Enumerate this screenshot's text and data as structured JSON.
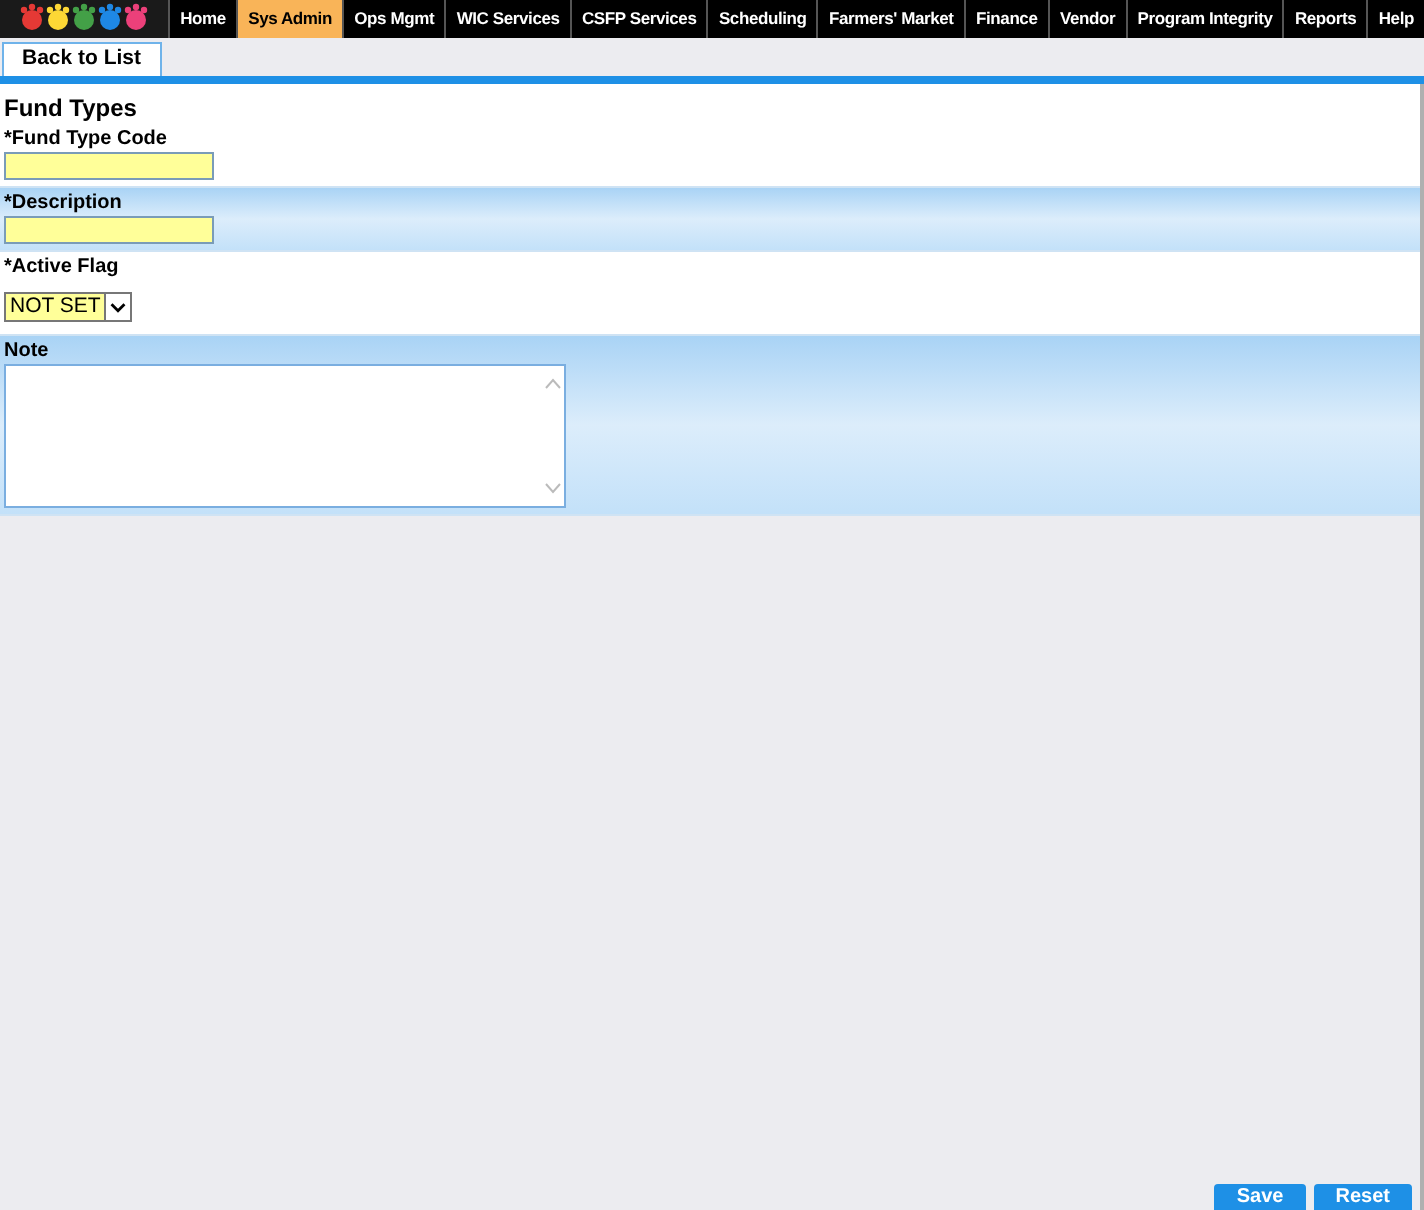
{
  "nav": [
    {
      "label": "Home",
      "selected": false
    },
    {
      "label": "Sys Admin",
      "selected": true
    },
    {
      "label": "Ops Mgmt",
      "selected": false
    },
    {
      "label": "WIC Services",
      "selected": false
    },
    {
      "label": "CSFP Services",
      "selected": false
    },
    {
      "label": "Scheduling",
      "selected": false
    },
    {
      "label": "Farmers' Market",
      "selected": false
    },
    {
      "label": "Finance",
      "selected": false
    },
    {
      "label": "Vendor",
      "selected": false
    },
    {
      "label": "Program Integrity",
      "selected": false
    },
    {
      "label": "Reports",
      "selected": false
    },
    {
      "label": "Help",
      "selected": false
    }
  ],
  "back_button": "Back to List",
  "form": {
    "title": "Fund Types",
    "fields": [
      {
        "kind": "text",
        "label": "*Fund Type Code"
      },
      {
        "kind": "text",
        "label": "*Description"
      },
      {
        "kind": "select",
        "label": "*Active Flag",
        "value": "NOT SET"
      },
      {
        "kind": "textarea",
        "label": "Note"
      }
    ]
  },
  "buttons": [
    "Save",
    "Reset"
  ]
}
